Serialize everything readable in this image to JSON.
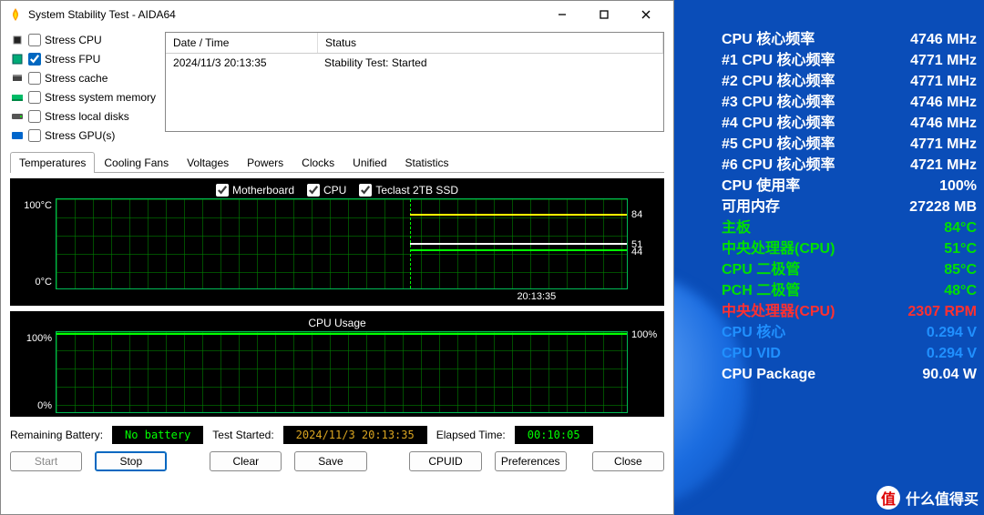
{
  "window": {
    "title": "System Stability Test - AIDA64"
  },
  "stress": {
    "items": [
      {
        "label": "Stress CPU",
        "checked": false
      },
      {
        "label": "Stress FPU",
        "checked": true
      },
      {
        "label": "Stress cache",
        "checked": false
      },
      {
        "label": "Stress system memory",
        "checked": false
      },
      {
        "label": "Stress local disks",
        "checked": false
      },
      {
        "label": "Stress GPU(s)",
        "checked": false
      }
    ]
  },
  "log": {
    "headers": [
      "Date / Time",
      "Status"
    ],
    "rows": [
      {
        "date": "2024/11/3 20:13:35",
        "status": "Stability Test: Started"
      }
    ]
  },
  "tabs": [
    "Temperatures",
    "Cooling Fans",
    "Voltages",
    "Powers",
    "Clocks",
    "Unified",
    "Statistics"
  ],
  "activeTab": "Temperatures",
  "tempGraph": {
    "legend": [
      "Motherboard",
      "CPU",
      "Teclast 2TB SSD"
    ],
    "yMax": "100°C",
    "yMin": "0°C",
    "rlabels": [
      "84",
      "51",
      "44"
    ],
    "xtick": "20:13:35"
  },
  "cpuGraph": {
    "title": "CPU Usage",
    "yMax": "100%",
    "yMin": "0%",
    "rlabel": "100%"
  },
  "status": {
    "batteryLabel": "Remaining Battery:",
    "batteryValue": "No battery",
    "startedLabel": "Test Started:",
    "startedValue": "2024/11/3 20:13:35",
    "elapsedLabel": "Elapsed Time:",
    "elapsedValue": "00:10:05"
  },
  "buttons": {
    "start": "Start",
    "stop": "Stop",
    "clear": "Clear",
    "save": "Save",
    "cpuid": "CPUID",
    "preferences": "Preferences",
    "close": "Close"
  },
  "hw": [
    {
      "label": "CPU 核心频率",
      "value": "4746 MHz"
    },
    {
      "label": "#1 CPU 核心频率",
      "value": "4771 MHz"
    },
    {
      "label": "#2 CPU 核心频率",
      "value": "4771 MHz"
    },
    {
      "label": "#3 CPU 核心频率",
      "value": "4746 MHz"
    },
    {
      "label": "#4 CPU 核心频率",
      "value": "4746 MHz"
    },
    {
      "label": "#5 CPU 核心频率",
      "value": "4771 MHz"
    },
    {
      "label": "#6 CPU 核心频率",
      "value": "4721 MHz"
    },
    {
      "label": "CPU 使用率",
      "value": "100%"
    },
    {
      "label": "可用内存",
      "value": "27228 MB"
    },
    {
      "label": "主板",
      "value": "84°C"
    },
    {
      "label": "中央处理器(CPU)",
      "value": "51°C"
    },
    {
      "label": "CPU 二极管",
      "value": "85°C"
    },
    {
      "label": "PCH 二极管",
      "value": "48°C"
    },
    {
      "label": "中央处理器(CPU)",
      "value": "2307 RPM"
    },
    {
      "label": "CPU 核心",
      "value": "0.294 V"
    },
    {
      "label": "CPU VID",
      "value": "0.294 V"
    },
    {
      "label": "CPU Package",
      "value": "90.04 W"
    }
  ],
  "watermark": "什么值得买",
  "chart_data": [
    {
      "type": "line",
      "title": "Temperatures",
      "ylabel": "°C",
      "ylim": [
        0,
        100
      ],
      "x_marker": "20:13:35",
      "series": [
        {
          "name": "Motherboard",
          "color": "#ffff00",
          "current": 84
        },
        {
          "name": "CPU",
          "color": "#ffffff",
          "current": 51
        },
        {
          "name": "Teclast 2TB SSD",
          "color": "#00ff00",
          "current": 44
        }
      ]
    },
    {
      "type": "line",
      "title": "CPU Usage",
      "ylabel": "%",
      "ylim": [
        0,
        100
      ],
      "series": [
        {
          "name": "CPU Usage",
          "color": "#00ff00",
          "current": 100
        }
      ]
    }
  ]
}
